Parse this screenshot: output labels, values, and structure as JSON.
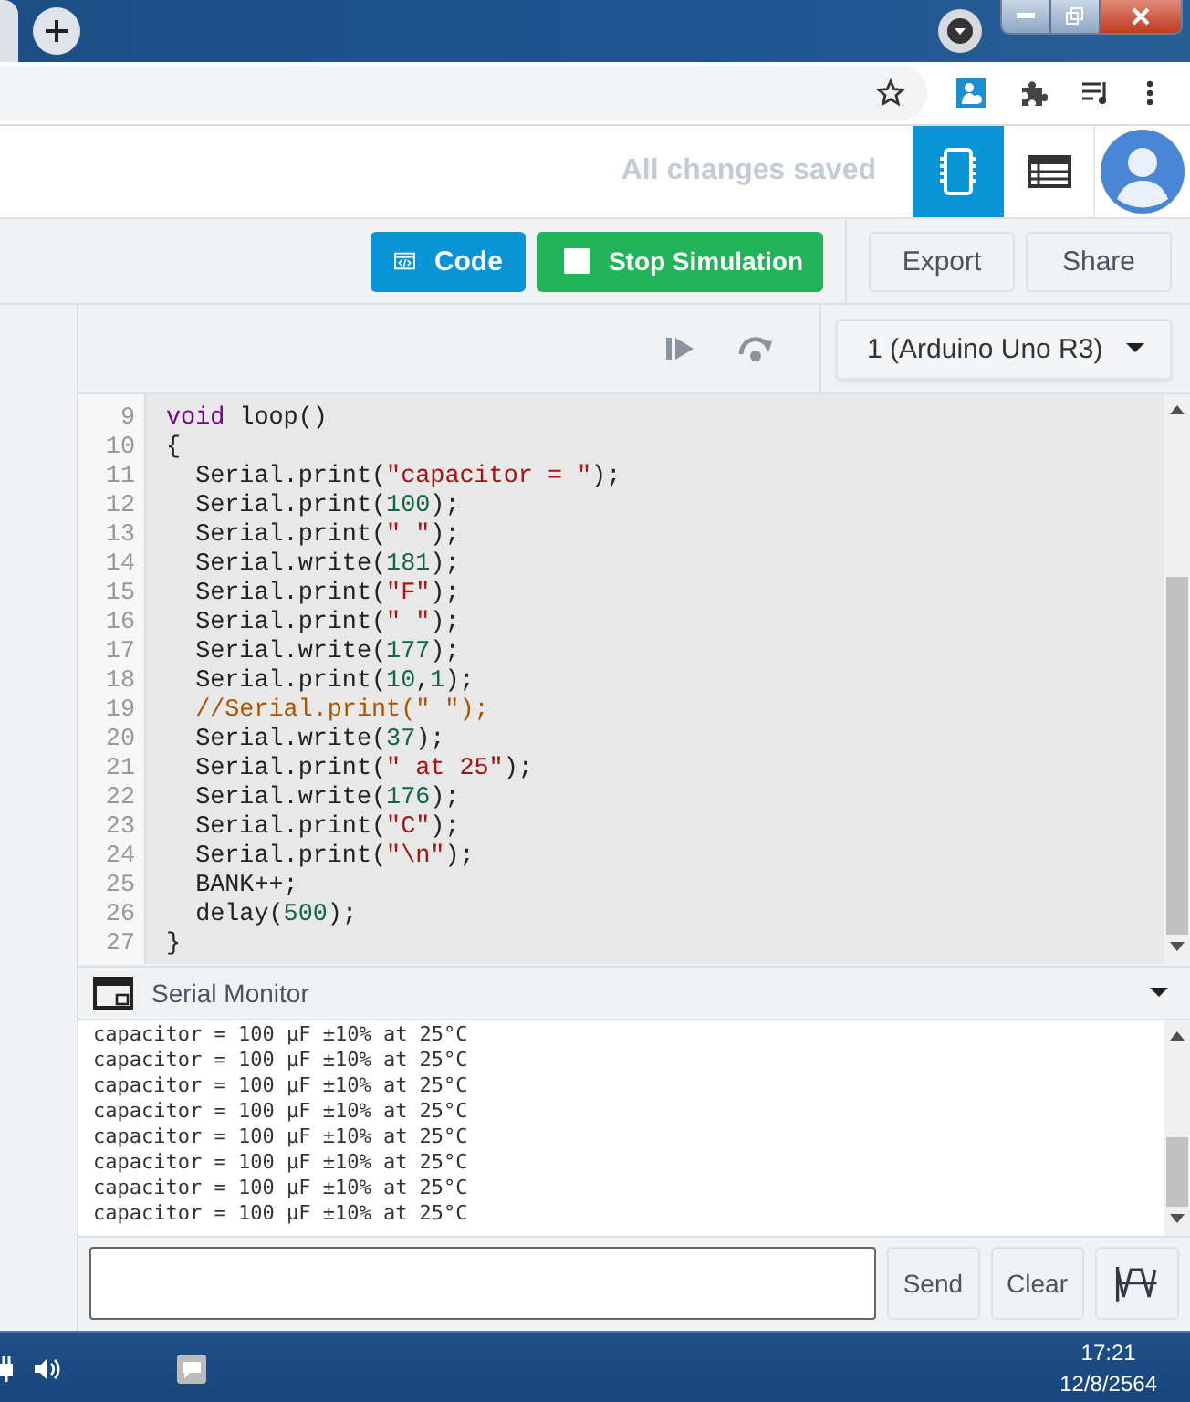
{
  "header": {
    "save_status": "All changes saved",
    "view_tabs": [
      {
        "selected": true
      },
      {
        "selected": false
      }
    ]
  },
  "toolbar": {
    "buttons": [
      {
        "label": "Code",
        "kind": "code"
      },
      {
        "label": "Stop Simulation",
        "kind": "stop"
      },
      {
        "label": "Export",
        "kind": "plain"
      },
      {
        "label": "Share",
        "kind": "plain"
      }
    ]
  },
  "board_select": {
    "value": "1 (Arduino Uno R3)"
  },
  "editor": {
    "lines": [
      {
        "number": "9",
        "tokens": [
          {
            "kind": "keyword",
            "text": "void"
          },
          {
            "kind": "plain",
            "text": " loop()"
          }
        ]
      },
      {
        "number": "10",
        "tokens": [
          {
            "kind": "plain",
            "text": "{"
          }
        ]
      },
      {
        "number": "11",
        "tokens": [
          {
            "kind": "plain",
            "text": "  Serial.print("
          },
          {
            "kind": "string",
            "text": "\"capacitor = \""
          },
          {
            "kind": "plain",
            "text": ");"
          }
        ]
      },
      {
        "number": "12",
        "tokens": [
          {
            "kind": "plain",
            "text": "  Serial.print("
          },
          {
            "kind": "number",
            "text": "100"
          },
          {
            "kind": "plain",
            "text": ");"
          }
        ]
      },
      {
        "number": "13",
        "tokens": [
          {
            "kind": "plain",
            "text": "  Serial.print("
          },
          {
            "kind": "string",
            "text": "\" \""
          },
          {
            "kind": "plain",
            "text": ");"
          }
        ]
      },
      {
        "number": "14",
        "tokens": [
          {
            "kind": "plain",
            "text": "  Serial.write("
          },
          {
            "kind": "number",
            "text": "181"
          },
          {
            "kind": "plain",
            "text": ");"
          }
        ]
      },
      {
        "number": "15",
        "tokens": [
          {
            "kind": "plain",
            "text": "  Serial.print("
          },
          {
            "kind": "string",
            "text": "\"F\""
          },
          {
            "kind": "plain",
            "text": ");"
          }
        ]
      },
      {
        "number": "16",
        "tokens": [
          {
            "kind": "plain",
            "text": "  Serial.print("
          },
          {
            "kind": "string",
            "text": "\" \""
          },
          {
            "kind": "plain",
            "text": ");"
          }
        ]
      },
      {
        "number": "17",
        "tokens": [
          {
            "kind": "plain",
            "text": "  Serial.write("
          },
          {
            "kind": "number",
            "text": "177"
          },
          {
            "kind": "plain",
            "text": ");"
          }
        ]
      },
      {
        "number": "18",
        "tokens": [
          {
            "kind": "plain",
            "text": "  Serial.print("
          },
          {
            "kind": "number",
            "text": "10"
          },
          {
            "kind": "plain",
            "text": ","
          },
          {
            "kind": "number",
            "text": "1"
          },
          {
            "kind": "plain",
            "text": ");"
          }
        ]
      },
      {
        "number": "19",
        "tokens": [
          {
            "kind": "comment",
            "text": "  //Serial.print(\" \");"
          }
        ]
      },
      {
        "number": "20",
        "tokens": [
          {
            "kind": "plain",
            "text": "  Serial.write("
          },
          {
            "kind": "number",
            "text": "37"
          },
          {
            "kind": "plain",
            "text": ");"
          }
        ]
      },
      {
        "number": "21",
        "tokens": [
          {
            "kind": "plain",
            "text": "  Serial.print("
          },
          {
            "kind": "string",
            "text": "\" at 25\""
          },
          {
            "kind": "plain",
            "text": ");"
          }
        ]
      },
      {
        "number": "22",
        "tokens": [
          {
            "kind": "plain",
            "text": "  Serial.write("
          },
          {
            "kind": "number",
            "text": "176"
          },
          {
            "kind": "plain",
            "text": ");"
          }
        ]
      },
      {
        "number": "23",
        "tokens": [
          {
            "kind": "plain",
            "text": "  Serial.print("
          },
          {
            "kind": "string",
            "text": "\"C\""
          },
          {
            "kind": "plain",
            "text": ");"
          }
        ]
      },
      {
        "number": "24",
        "tokens": [
          {
            "kind": "plain",
            "text": "  Serial.print("
          },
          {
            "kind": "string",
            "text": "\"\\n\""
          },
          {
            "kind": "plain",
            "text": ");"
          }
        ]
      },
      {
        "number": "25",
        "tokens": [
          {
            "kind": "plain",
            "text": "  BANK++;"
          }
        ]
      },
      {
        "number": "26",
        "tokens": [
          {
            "kind": "plain",
            "text": "  delay("
          },
          {
            "kind": "number",
            "text": "500"
          },
          {
            "kind": "plain",
            "text": ");"
          }
        ]
      },
      {
        "number": "27",
        "tokens": [
          {
            "kind": "plain",
            "text": "}"
          }
        ]
      }
    ]
  },
  "serial_monitor": {
    "title": "Serial Monitor",
    "output": [
      "capacitor = 100 µF ±10% at 25°C",
      "capacitor = 100 µF ±10% at 25°C",
      "capacitor = 100 µF ±10% at 25°C",
      "capacitor = 100 µF ±10% at 25°C",
      "capacitor = 100 µF ±10% at 25°C",
      "capacitor = 100 µF ±10% at 25°C",
      "capacitor = 100 µF ±10% at 25°C",
      "capacitor = 100 µF ±10% at 25°C"
    ],
    "buttons": [
      {
        "label": "Send"
      },
      {
        "label": "Clear"
      }
    ]
  },
  "taskbar": {
    "time": "17:21",
    "date": "12/8/2564"
  }
}
